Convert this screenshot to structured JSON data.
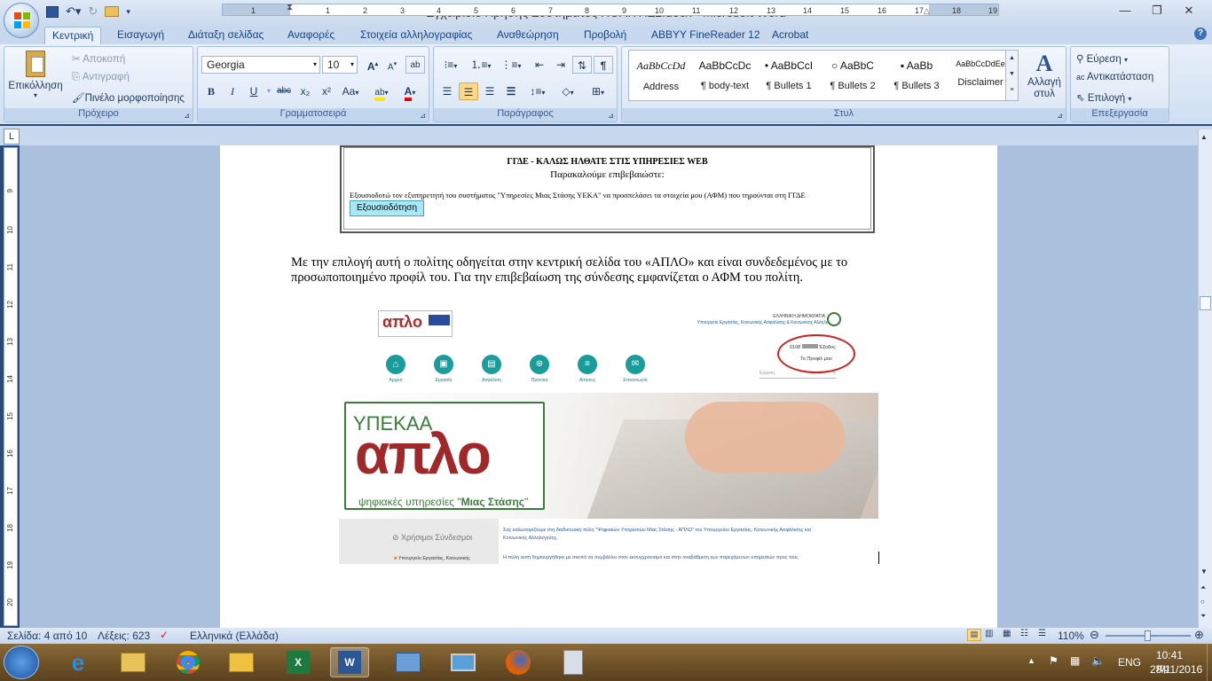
{
  "window": {
    "title": "Εγχειρίδιο Χρήσης Συστήματος ΠΟΛΙΤΗΣ2.docx - Microsoft Word",
    "min": "—",
    "max": "❐",
    "close": "✕"
  },
  "tabs": [
    "Κεντρική",
    "Εισαγωγή",
    "Διάταξη σελίδας",
    "Αναφορές",
    "Στοιχεία αλληλογραφίας",
    "Αναθεώρηση",
    "Προβολή",
    "ABBYY FineReader 12",
    "Acrobat"
  ],
  "clipboard": {
    "paste": "Επικόλληση",
    "cut": "Αποκοπή",
    "copy": "Αντιγραφή",
    "format_painter": "Πινέλο μορφοποίησης",
    "label": "Πρόχειρο"
  },
  "font": {
    "name": "Georgia",
    "size": "10",
    "label": "Γραμματοσειρά",
    "bold": "B",
    "italic": "I",
    "underline": "U",
    "strike": "abc",
    "sub": "x₂",
    "sup": "x²",
    "case": "Aa",
    "color": "A",
    "grow": "A",
    "shrink": "A"
  },
  "paragraph": {
    "label": "Παράγραφος"
  },
  "styles": {
    "label": "Στυλ",
    "items": [
      {
        "preview": "AaBbCcDd",
        "name": "Address"
      },
      {
        "preview": "AaBbCcDc",
        "name": "¶ body-text"
      },
      {
        "preview": "• AaBbCcI",
        "name": "¶ Bullets 1"
      },
      {
        "preview": "○   AaBbC",
        "name": "¶ Bullets 2"
      },
      {
        "preview": "▪     AaBb",
        "name": "¶ Bullets 3"
      },
      {
        "preview": "AaBbCcDdEe",
        "name": "Disclaimer"
      }
    ],
    "change": "Αλλαγή στυλ"
  },
  "editing": {
    "label": "Επεξεργασία",
    "find": "Εύρεση",
    "replace": "Αντικατάσταση",
    "select": "Επιλογή"
  },
  "ruler": {
    "h": [
      "1",
      "1",
      "2",
      "3",
      "4",
      "5",
      "6",
      "7",
      "8",
      "9",
      "10",
      "11",
      "12",
      "13",
      "14",
      "15",
      "16",
      "17",
      "18",
      "19"
    ],
    "v": [
      "9",
      "10",
      "11",
      "12",
      "13",
      "14",
      "15",
      "16",
      "17",
      "18",
      "19",
      "20",
      "21"
    ]
  },
  "consent": {
    "title": "ΓΓΔΕ - ΚΑΛΩΣ ΗΛΘΑΤΕ ΣΤΙΣ ΥΠΗΡΕΣΙΕΣ WEB",
    "subtitle": "Παρακαλούμε επιβεβαιώστε:",
    "text": "Εξουσιοδοτώ τον εξυπηρετητή του συστήματος \"Υπηρεσίες Μιας Στάσης ΥΕΚΑ\" να προσπελάσει τα στοιχεία μου (ΑΦΜ) που τηρούνται στη ΓΓΔΕ",
    "button": "Εξουσιοδότηση"
  },
  "body_text": "Με την επιλογή αυτή ο πολίτης οδηγείται στην κεντρική σελίδα του «ΑΠΛΟ»  και είναι συνδεδεμένος με το προσωποποιημένο προφίλ του. Για την επιβεβαίωση της σύνδεσης εμφανίζεται ο ΑΦΜ του πολίτη.",
  "screenshot": {
    "logo_small": "απλο",
    "gov": "ΕΛΛΗΝΙΚΗ ΔΗΜΟΚΡΑΤΙΑ",
    "ministry": "Υπουργείο Εργασίας, Κοινωνικής Ασφάλισης & Κοινωνικής Αλληλεγγύης",
    "afm": "0108",
    "logout": "Έξοδος",
    "profile": "Το Προφίλ μου",
    "search": "Εύρεση",
    "nav": [
      "Αρχική",
      "Εργασία",
      "Ασφάλιση",
      "Πρόνοια",
      "Αιτήσεις",
      "Επικοινωνία"
    ],
    "banner_ministry": "ΥΠΕΚΑΑ",
    "banner_logo": "απλο",
    "banner_tag_a": "ψηφιακές υπηρεσίες \"",
    "banner_tag_b": "Μιας Στάσης",
    "banner_tag_c": "\"",
    "useful_links": "Χρήσιμοι Σύνδεσμοι",
    "link1": "Υπουργείο Εργασίας, Κοινωνικής",
    "welcome": "Σας καλωσορίζουμε στη διαδικτυακή πύλη \"Ψηφιακών Υπηρεσιών Μιας Στάσης - ΑΠΛΟ\" του Υπουργείου Εργασίας, Κοινωνικής Ασφάλισης και Κοινωνικής Αλληλεγγύης.",
    "para2": "Η πύλη αυτή δημιουργήθηκε με σκοπό να συμβάλλει στον εκσυγχρονισμό και στην αναβάθμιση των παρεχόμενων υπηρεσιών προς τους"
  },
  "status": {
    "page": "Σελίδα: 4 από 10",
    "words": "Λέξεις: 623",
    "lang": "Ελληνικά (Ελλάδα)",
    "zoom": "110%"
  },
  "tray": {
    "lang": "ENG",
    "time": "10:41 πμ",
    "date": "28/11/2016"
  },
  "colors": {
    "accent": "#15428b",
    "teal": "#1a9c9a",
    "red": "#b02a2a",
    "orange": "#e58a1f",
    "green": "#3a7d3a"
  }
}
